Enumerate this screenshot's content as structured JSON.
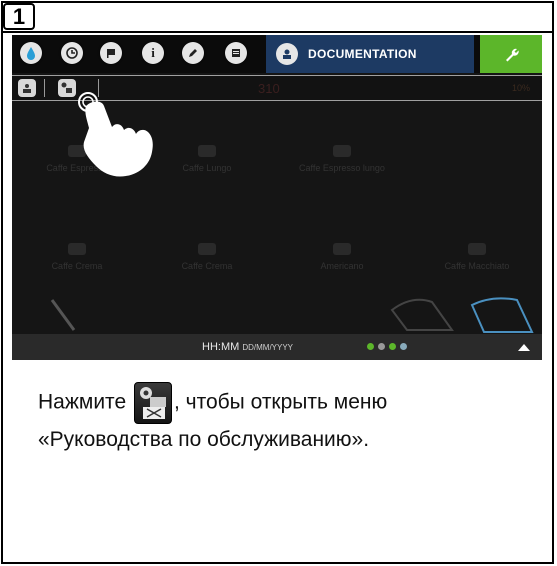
{
  "step_number": "1",
  "screen": {
    "top_icons": [
      "water-drop-icon",
      "clock-icon",
      "flag-icon",
      "info-icon",
      "pencil-icon",
      "document-icon"
    ],
    "documentation_tab": {
      "label": "DOCUMENTATION",
      "icon": "documentation-icon"
    },
    "settings_button": {
      "icon": "wrench-icon",
      "color": "#5cb62a"
    },
    "sub_toolbar": {
      "icons": [
        "documentation-icon",
        "service-manual-icon"
      ]
    },
    "faint_center_text": "310",
    "faint_right_text": "10%",
    "tiles_row1": [
      "Caffe Espresso",
      "Caffe Lungo",
      "Caffe Espresso lungo"
    ],
    "tiles_row2": [
      "Caffe Crema",
      "Caffe Crema",
      "Americano",
      "Caffe Macchiato"
    ],
    "status_bar": {
      "time": "HH:MM",
      "date": "DD/MM/YYYY"
    }
  },
  "instruction": {
    "before_icon": "Нажмите",
    "after_icon": ", чтобы открыть меню «Руководства по обслуживанию»."
  },
  "colors": {
    "doc_tab": "#1d3a63",
    "wrench_bg": "#5cb62a",
    "screen_bg": "#151515"
  }
}
